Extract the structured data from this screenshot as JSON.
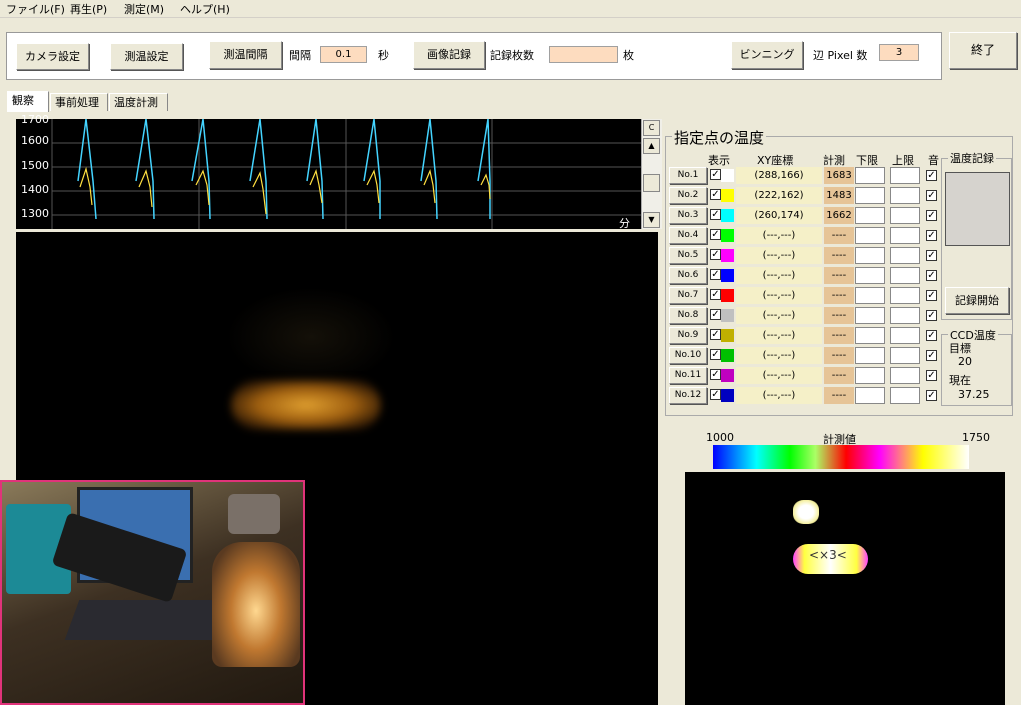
{
  "menu": [
    "ファイル(F)",
    "再生(P)",
    "測定(M)",
    "ヘルプ(H)"
  ],
  "toolbar": {
    "camera_settings": "カメラ設定",
    "temp_settings": "測温設定",
    "temp_interval": "測温間隔",
    "interval_label": "間隔",
    "interval_value": "0.1",
    "interval_unit": "秒",
    "image_record": "画像記録",
    "record_count_label": "記録枚数",
    "record_count_value": "",
    "record_count_unit": "枚",
    "binning": "ビンニング",
    "edge_pixel_label": "辺 Pixel 数",
    "edge_pixel_value": "3"
  },
  "exit_button": "終了",
  "tabs": [
    "観察",
    "事前処理",
    "温度計測"
  ],
  "graph": {
    "y_ticks": [
      "1700",
      "1600",
      "1500",
      "1400",
      "1300"
    ],
    "x_unit": "分",
    "scroll_top_label": "C"
  },
  "points_panel": {
    "title": "指定点の温度",
    "headers": {
      "show": "表示",
      "xy": "XY座標",
      "measure": "計測",
      "lower": "下限",
      "upper": "上限",
      "sound": "音"
    },
    "rows": [
      {
        "label": "No.1",
        "color": "#ffffff",
        "xy": "(288,166)",
        "value": "1683"
      },
      {
        "label": "No.2",
        "color": "#ffff00",
        "xy": "(222,162)",
        "value": "1483"
      },
      {
        "label": "No.3",
        "color": "#00ffff",
        "xy": "(260,174)",
        "value": "1662"
      },
      {
        "label": "No.4",
        "color": "#00ff00",
        "xy": "(---,---)",
        "value": "----"
      },
      {
        "label": "No.5",
        "color": "#ff00ff",
        "xy": "(---,---)",
        "value": "----"
      },
      {
        "label": "No.6",
        "color": "#0000ff",
        "xy": "(---,---)",
        "value": "----"
      },
      {
        "label": "No.7",
        "color": "#ff0000",
        "xy": "(---,---)",
        "value": "----"
      },
      {
        "label": "No.8",
        "color": "#c0c0c0",
        "xy": "(---,---)",
        "value": "----"
      },
      {
        "label": "No.9",
        "color": "#c0b000",
        "xy": "(---,---)",
        "value": "----"
      },
      {
        "label": "No.10",
        "color": "#00c000",
        "xy": "(---,---)",
        "value": "----"
      },
      {
        "label": "No.11",
        "color": "#c000c0",
        "xy": "(---,---)",
        "value": "----"
      },
      {
        "label": "No.12",
        "color": "#0000c0",
        "xy": "(---,---)",
        "value": "----"
      }
    ],
    "temp_record_title": "温度記録",
    "record_start": "記録開始",
    "ccd_title": "CCD温度",
    "target_label": "目標",
    "target_value": "20",
    "current_label": "現在",
    "current_value": "37.25"
  },
  "colorbar": {
    "min": "1000",
    "label": "計測値",
    "max": "1750"
  }
}
